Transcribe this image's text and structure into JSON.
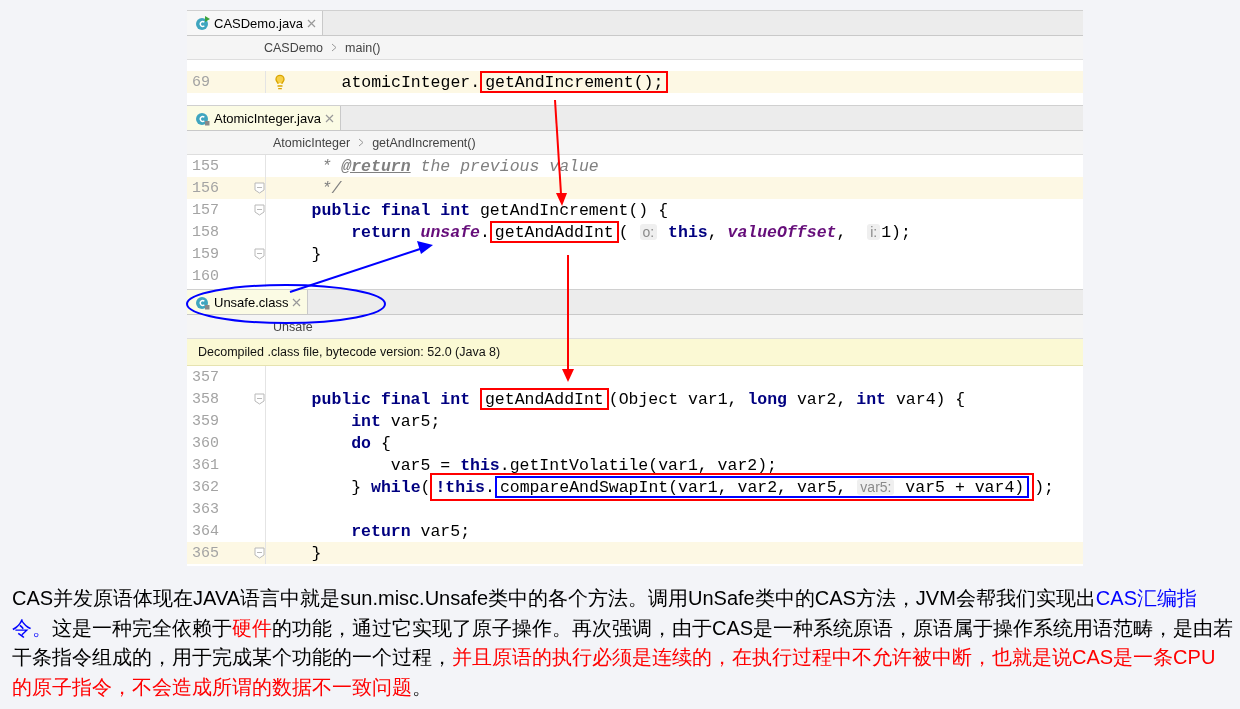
{
  "editor": {
    "panes": [
      {
        "tab": {
          "label": "CASDemo.java",
          "read_only": false
        },
        "breadcrumb": [
          "CASDemo",
          "main()"
        ],
        "lines": [
          {
            "number": "69",
            "highlighted": true,
            "bulb": true,
            "tokens": [
              {
                "kind": "plain",
                "text": "     atomicInteger."
              },
              {
                "kind": "box",
                "color": "#ff0000",
                "tokens": [
                  {
                    "kind": "plain",
                    "text": "getAndIncrement();"
                  }
                ]
              }
            ]
          }
        ]
      },
      {
        "tab": {
          "label": "AtomicInteger.java",
          "read_only": true
        },
        "breadcrumb": [
          "AtomicInteger",
          "getAndIncrement()"
        ],
        "lines": [
          {
            "number": "155",
            "highlighted": false,
            "tokens": [
              {
                "kind": "comment",
                "text": "     * "
              },
              {
                "kind": "doctag",
                "text": "@return"
              },
              {
                "kind": "comment",
                "text": " the previous value"
              }
            ]
          },
          {
            "number": "156",
            "highlighted": true,
            "fold": true,
            "tokens": [
              {
                "kind": "comment",
                "text": "     */"
              }
            ]
          },
          {
            "number": "157",
            "highlighted": false,
            "fold": true,
            "tokens": [
              {
                "kind": "keyword",
                "text": "    public final int"
              },
              {
                "kind": "plain",
                "text": " getAndIncrement() {"
              }
            ]
          },
          {
            "number": "158",
            "highlighted": false,
            "tokens": [
              {
                "kind": "keyword",
                "text": "        return "
              },
              {
                "kind": "field",
                "text": "unsafe"
              },
              {
                "kind": "plain",
                "text": "."
              },
              {
                "kind": "box",
                "color": "#ff0000",
                "tokens": [
                  {
                    "kind": "plain",
                    "text": "getAndAddInt"
                  }
                ]
              },
              {
                "kind": "plain",
                "text": "( "
              },
              {
                "kind": "hint",
                "text": "o:"
              },
              {
                "kind": "keyword",
                "text": " this"
              },
              {
                "kind": "plain",
                "text": ", "
              },
              {
                "kind": "field",
                "text": "valueOffset"
              },
              {
                "kind": "plain",
                "text": ",  "
              },
              {
                "kind": "hint",
                "text": "i:"
              },
              {
                "kind": "plain",
                "text": "1);"
              }
            ]
          },
          {
            "number": "159",
            "highlighted": false,
            "fold": true,
            "tokens": [
              {
                "kind": "plain",
                "text": "    }"
              }
            ]
          },
          {
            "number": "160",
            "highlighted": false
          }
        ]
      },
      {
        "tab": {
          "label": "Unsafe.class",
          "read_only": true
        },
        "breadcrumb": [
          "Unsafe"
        ],
        "banner": "Decompiled .class file, bytecode version: 52.0 (Java 8)",
        "lines": [
          {
            "number": "357",
            "highlighted": false
          },
          {
            "number": "358",
            "highlighted": false,
            "fold": true,
            "tokens": [
              {
                "kind": "keyword",
                "text": "    public final int "
              },
              {
                "kind": "box",
                "color": "#ff0000",
                "tokens": [
                  {
                    "kind": "plain",
                    "text": "getAndAddInt"
                  }
                ]
              },
              {
                "kind": "plain",
                "text": "(Object var1, "
              },
              {
                "kind": "keyword",
                "text": "long"
              },
              {
                "kind": "plain",
                "text": " var2, "
              },
              {
                "kind": "keyword",
                "text": "int"
              },
              {
                "kind": "plain",
                "text": " var4) {"
              }
            ]
          },
          {
            "number": "359",
            "highlighted": false,
            "tokens": [
              {
                "kind": "keyword",
                "text": "        int"
              },
              {
                "kind": "plain",
                "text": " var5;"
              }
            ]
          },
          {
            "number": "360",
            "highlighted": false,
            "tokens": [
              {
                "kind": "keyword",
                "text": "        do"
              },
              {
                "kind": "plain",
                "text": " {"
              }
            ]
          },
          {
            "number": "361",
            "highlighted": false,
            "tokens": [
              {
                "kind": "plain",
                "text": "            var5 = "
              },
              {
                "kind": "keyword",
                "text": "this"
              },
              {
                "kind": "plain",
                "text": ".getIntVolatile(var1, var2);"
              }
            ]
          },
          {
            "number": "362",
            "highlighted": false,
            "tokens": [
              {
                "kind": "plain",
                "text": "        } "
              },
              {
                "kind": "keyword",
                "text": "while"
              },
              {
                "kind": "plain",
                "text": "("
              },
              {
                "kind": "box",
                "color": "#ff0000",
                "tokens": [
                  {
                    "kind": "keyword",
                    "text": "!this"
                  },
                  {
                    "kind": "plain",
                    "text": "."
                  },
                  {
                    "kind": "box",
                    "color": "#0000ff",
                    "tokens": [
                      {
                        "kind": "plain",
                        "text": "compareAndSwapInt(var1, var2, var5, "
                      },
                      {
                        "kind": "hint",
                        "text": "var5:"
                      },
                      {
                        "kind": "plain",
                        "text": " var5 + var4)"
                      }
                    ]
                  }
                ]
              },
              {
                "kind": "plain",
                "text": ");"
              }
            ]
          },
          {
            "number": "363",
            "highlighted": false
          },
          {
            "number": "364",
            "highlighted": false,
            "tokens": [
              {
                "kind": "keyword",
                "text": "        return"
              },
              {
                "kind": "plain",
                "text": " var5;"
              }
            ]
          },
          {
            "number": "365",
            "highlighted": true,
            "fold": true,
            "tokens": [
              {
                "kind": "plain",
                "text": "    }"
              }
            ]
          }
        ]
      }
    ]
  },
  "paragraph": [
    {
      "text": "CAS并发原语体现在JAVA语言中就是sun.misc.Unsafe类中的各个方法。调用UnSafe类中的CAS方法，JVM会帮我们实现出"
    },
    {
      "text": "CAS汇编指令。",
      "color": "#0000ff"
    },
    {
      "text": "这是一种完全依赖于"
    },
    {
      "text": "硬件",
      "color": "#ff0000"
    },
    {
      "text": "的功能，通过它实现了原子操作。再次强调，由于CAS是一种系统原语，原语属于操作系统用语范畴，是由若干条指令组成的，用于完成某个功能的一个过程，"
    },
    {
      "text": "并且原语的执行必须是连续的，在执行过程中不允许被中断，也就是说CAS是一条CPU的原子指令，不会造成所谓的数据不一致问题",
      "color": "#ff0000"
    },
    {
      "text": "。"
    }
  ]
}
